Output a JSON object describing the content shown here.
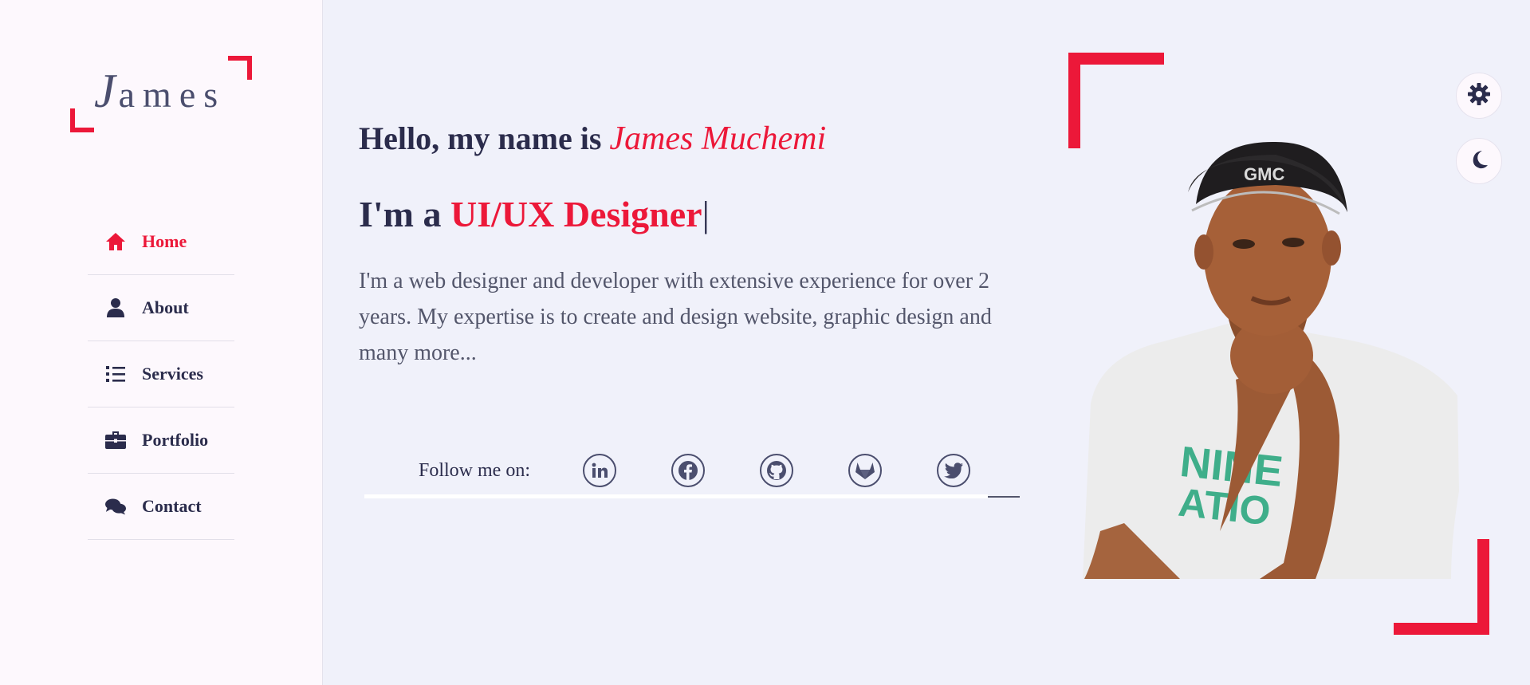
{
  "logo": {
    "first_letter": "J",
    "rest": "ames"
  },
  "nav": {
    "items": [
      {
        "label": "Home",
        "icon": "home-icon",
        "active": true
      },
      {
        "label": "About",
        "icon": "user-icon",
        "active": false
      },
      {
        "label": "Services",
        "icon": "list-icon",
        "active": false
      },
      {
        "label": "Portfolio",
        "icon": "briefcase-icon",
        "active": false
      },
      {
        "label": "Contact",
        "icon": "comments-icon",
        "active": false
      }
    ]
  },
  "hero": {
    "greeting": "Hello, my name is",
    "name": "James Muchemi",
    "role_prefix": "I'm a",
    "role": "UI/UX Designer",
    "cursor": "|",
    "description": "I'm a web designer and developer with extensive experience for over 2 years. My expertise is to create and design website, graphic design and many more..."
  },
  "social": {
    "label": "Follow me on:",
    "links": [
      "linkedin-icon",
      "facebook-icon",
      "github-icon",
      "gitlab-icon",
      "twitter-icon"
    ]
  },
  "tools": {
    "settings_icon": "gear-icon",
    "theme_icon": "moon-icon"
  },
  "colors": {
    "accent": "#ec1839",
    "text_dark": "#2b2c4c",
    "text_body": "#53566b",
    "sidebar_bg": "#fdf8fd",
    "page_bg": "#f0f1fa"
  }
}
